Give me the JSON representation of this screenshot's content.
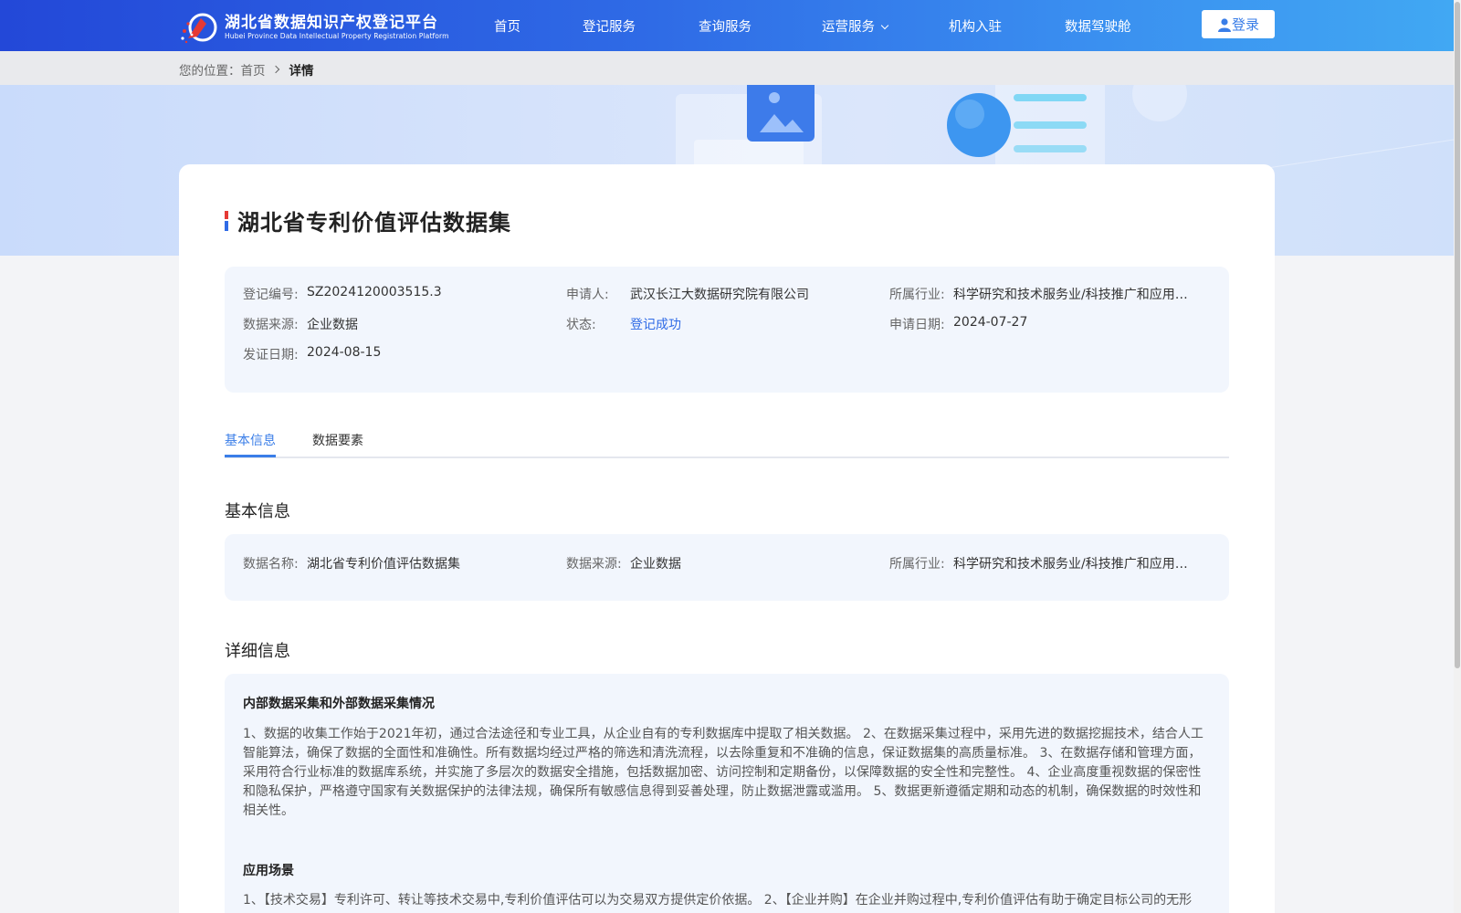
{
  "header": {
    "logo_title": "湖北省数据知识产权登记平台",
    "logo_subtitle": "Hubei Province Data Intellectual Property Registration Platform",
    "nav": [
      {
        "label": "首页"
      },
      {
        "label": "登记服务"
      },
      {
        "label": "查询服务"
      },
      {
        "label": "运营服务",
        "has_dropdown": true
      },
      {
        "label": "机构入驻"
      },
      {
        "label": "数据驾驶舱"
      }
    ],
    "login_label": "登录"
  },
  "breadcrumb": {
    "prefix": "您的位置：",
    "home": "首页",
    "current": "详情"
  },
  "detail": {
    "title": "湖北省专利价值评估数据集",
    "info": {
      "reg_no_label": "登记编号:",
      "reg_no": "SZ2024120003515.3",
      "applicant_label": "申请人:",
      "applicant": "武汉长江大数据研究院有限公司",
      "industry_label": "所属行业:",
      "industry": "科学研究和技术服务业/科技推广和应用服务业",
      "source_label": "数据来源:",
      "source": "企业数据",
      "status_label": "状态:",
      "status": "登记成功",
      "apply_date_label": "申请日期:",
      "apply_date": "2024-07-27",
      "issue_date_label": "发证日期:",
      "issue_date": "2024-08-15"
    },
    "tabs": [
      {
        "label": "基本信息",
        "active": true
      },
      {
        "label": "数据要素",
        "active": false
      }
    ],
    "basic": {
      "section_title": "基本信息",
      "name_label": "数据名称:",
      "name": "湖北省专利价值评估数据集",
      "source_label": "数据来源:",
      "source": "企业数据",
      "industry_label": "所属行业:",
      "industry": "科学研究和技术服务业/科技推广和应用服务业"
    },
    "detailed": {
      "section_title": "详细信息",
      "collection_title": "内部数据采集和外部数据采集情况",
      "collection_text": "1、数据的收集工作始于2021年初，通过合法途径和专业工具，从企业自有的专利数据库中提取了相关数据。 2、在数据采集过程中，采用先进的数据挖掘技术，结合人工智能算法，确保了数据的全面性和准确性。所有数据均经过严格的筛选和清洗流程，以去除重复和不准确的信息，保证数据集的高质量标准。 3、在数据存储和管理方面，采用符合行业标准的数据库系统，并实施了多层次的数据安全措施，包括数据加密、访问控制和定期备份，以保障数据的安全性和完整性。 4、企业高度重视数据的保密性和隐私保护，严格遵守国家有关数据保护的法律法规，确保所有敏感信息得到妥善处理，防止数据泄露或滥用。 5、数据更新遵循定期和动态的机制，确保数据的时效性和相关性。",
      "scenario_title": "应用场景",
      "scenario_text": "1、【技术交易】专利许可、转让等技术交易中,专利价值评估可以为交易双方提供定价依据。 2、【企业并购】在企业并购过程中,专利价值评估有助于确定目标公司的无形"
    }
  },
  "colors": {
    "header_start": "#2348d8",
    "header_end": "#41a8f3",
    "accent": "#3a7ee8",
    "status": "#2f6be6"
  }
}
